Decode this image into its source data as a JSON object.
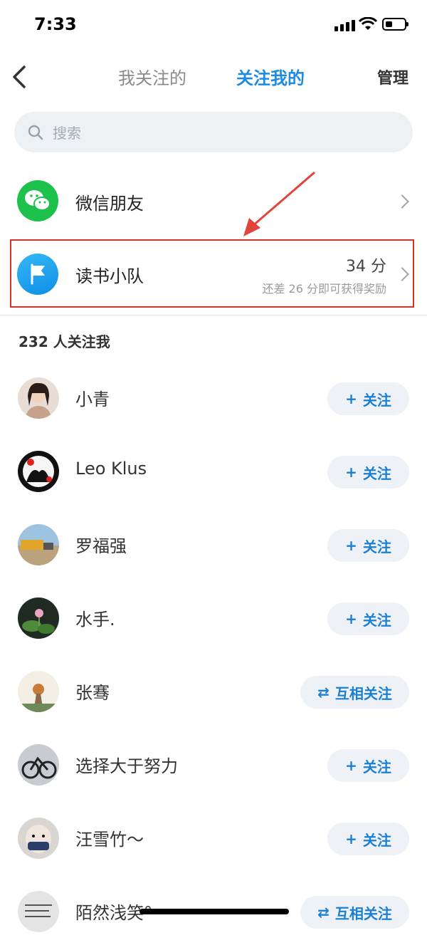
{
  "status": {
    "time": "7:33"
  },
  "nav": {
    "tab_following": "我关注的",
    "tab_followers": "关注我的",
    "manage": "管理"
  },
  "search": {
    "placeholder": "搜索"
  },
  "wechat": {
    "label": "微信朋友"
  },
  "team": {
    "label": "读书小队",
    "score": "34 分",
    "hint": "还差 26 分即可获得奖励"
  },
  "followers_count": "232 人关注我",
  "followers": [
    {
      "name": "小青",
      "action": "关注",
      "symbol": "+"
    },
    {
      "name": "Leo Klus",
      "action": "关注",
      "symbol": "+"
    },
    {
      "name": "罗福强",
      "action": "关注",
      "symbol": "+"
    },
    {
      "name": "水手.",
      "action": "关注",
      "symbol": "+"
    },
    {
      "name": "张骞",
      "action": "互相关注",
      "symbol": "⇄"
    },
    {
      "name": "选择大于努力",
      "action": "关注",
      "symbol": "+"
    },
    {
      "name": "汪雪竹～",
      "action": "关注",
      "symbol": "+"
    },
    {
      "name": "陌然浅笑°",
      "action": "互相关注",
      "symbol": "⇄"
    }
  ],
  "colors": {
    "accent": "#1d8ce0",
    "highlight_border": "#d9312b",
    "wechat_green": "#1fc14d"
  }
}
